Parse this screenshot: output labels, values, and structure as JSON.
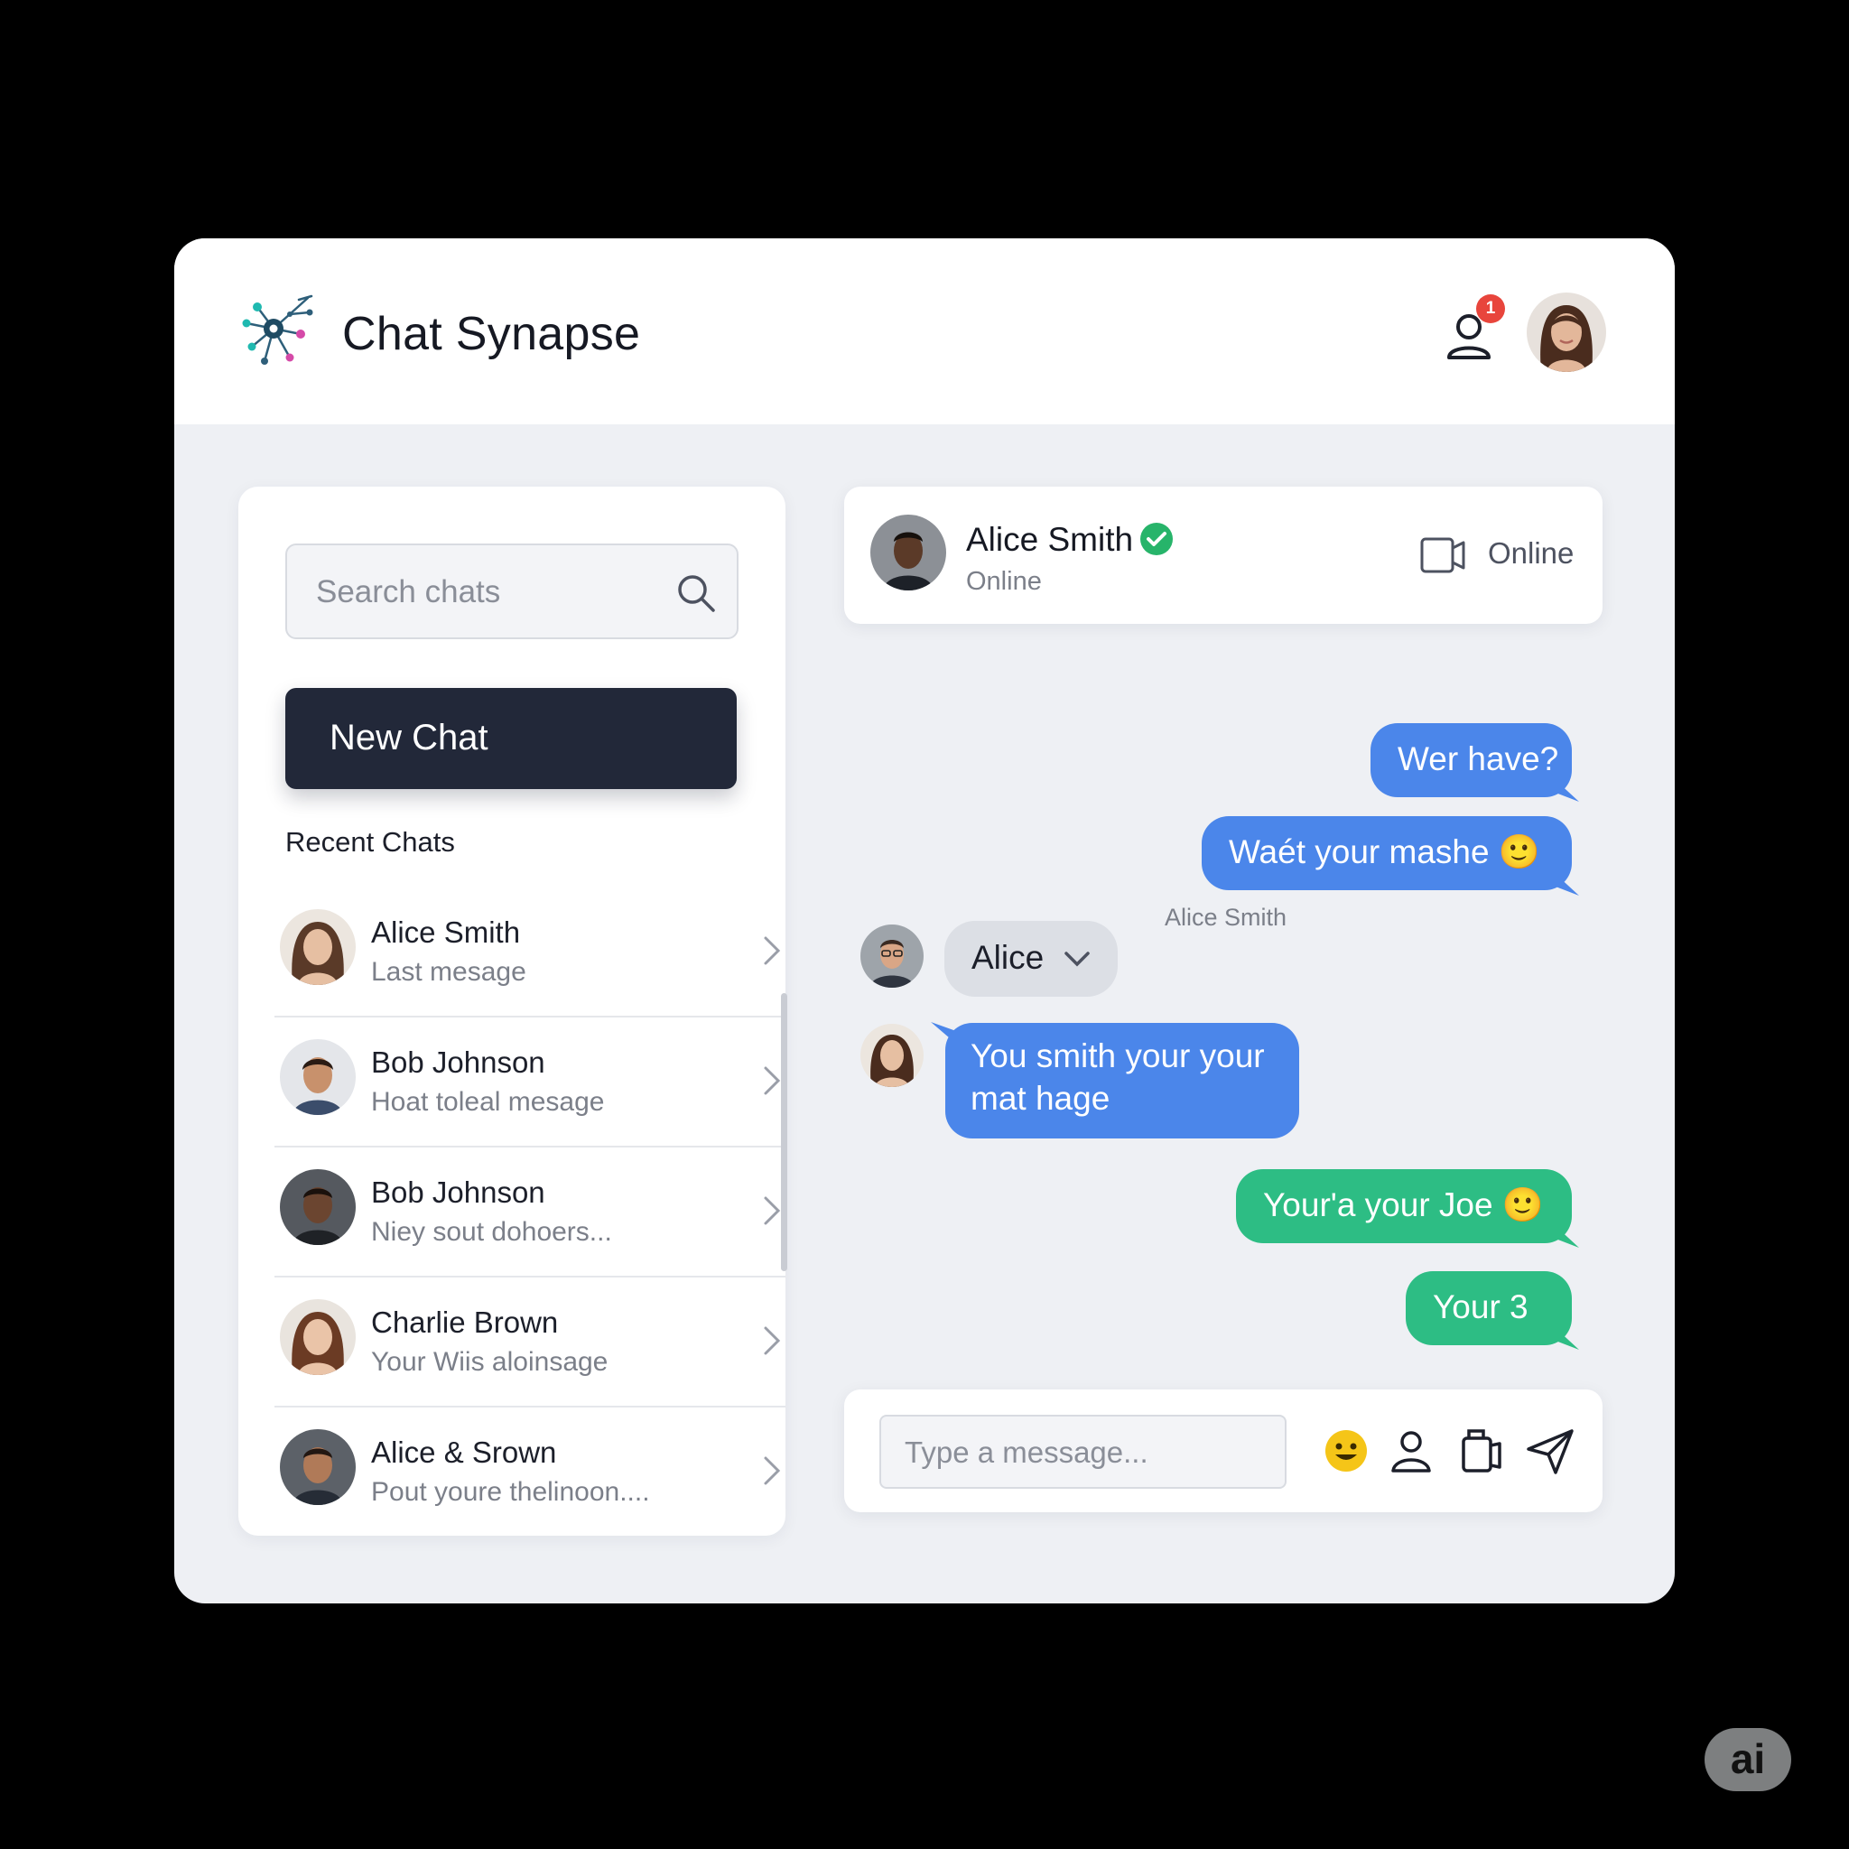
{
  "header": {
    "app_title": "Chat Synapse",
    "notification_count": "1"
  },
  "sidebar": {
    "search_placeholder": "Search chats",
    "new_chat_label": "New Chat",
    "recent_label": "Recent Chats",
    "chats": [
      {
        "name": "Alice Smith",
        "preview": "Last mesage"
      },
      {
        "name": "Bob Johnson",
        "preview": "Hoat toleal mesage"
      },
      {
        "name": "Bob Johnson",
        "preview": "Niey sout dohoers..."
      },
      {
        "name": "Charlie Brown",
        "preview": "Your Wiis aloinsage"
      },
      {
        "name": "Alice & Srown",
        "preview": "Pout youre thelinoon...."
      }
    ]
  },
  "conversation": {
    "contact_name": "Alice Smith",
    "contact_status": "Online",
    "header_status_label": "Online",
    "day_label": "Alice Smith",
    "messages": [
      {
        "text": "Wer have?"
      },
      {
        "text": "Waét your mashe 🙂"
      },
      {
        "text": "Alice"
      },
      {
        "text_line1": "You smith your your",
        "text_line2": "mat hage"
      },
      {
        "text": "Your'a your Joe 🙂"
      },
      {
        "text": "Your  3"
      }
    ],
    "composer_placeholder": "Type a message..."
  },
  "colors": {
    "outgoing_blue": "#4b86ea",
    "outgoing_green": "#2dbd84",
    "primary_dark": "#222839",
    "badge_red": "#e8453c",
    "verified_green": "#27b46a"
  },
  "icons": [
    "network-logo-icon",
    "user-notification-icon",
    "search-icon",
    "chevron-right-icon",
    "verified-check-icon",
    "video-call-icon",
    "chevron-down-icon",
    "emoji-icon",
    "contact-icon",
    "attachment-icon",
    "send-icon"
  ],
  "watermark": "ai"
}
